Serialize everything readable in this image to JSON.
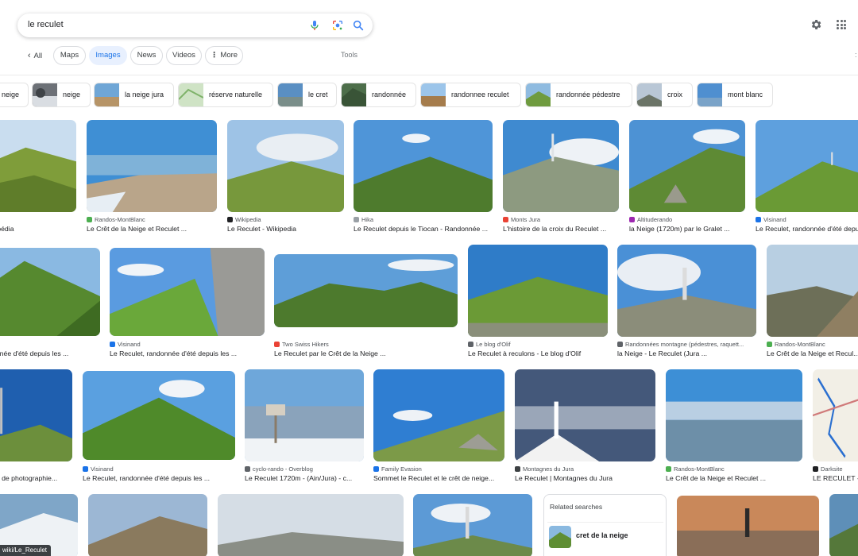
{
  "search": {
    "query": "le reculet"
  },
  "tabs": [
    {
      "key": "all",
      "label": "All"
    },
    {
      "key": "maps",
      "label": "Maps"
    },
    {
      "key": "images",
      "label": "Images"
    },
    {
      "key": "news",
      "label": "News"
    },
    {
      "key": "videos",
      "label": "Videos"
    },
    {
      "key": "more",
      "label": "More"
    }
  ],
  "tools_label": "Tools",
  "chips": [
    "neige",
    "neige",
    "la neige jura",
    "réserve naturelle",
    "le cret",
    "randonnée",
    "randonnee reculet",
    "randonnée pédestre",
    "croix",
    "mont blanc"
  ],
  "results": [
    {
      "source": "",
      "title": "kipédia"
    },
    {
      "source": "Randos-MontBlanc",
      "title": "Le Crêt de la Neige et Reculet ..."
    },
    {
      "source": "Wikipedia",
      "title": "Le Reculet - Wikipedia"
    },
    {
      "source": "Hika",
      "title": "Le Reculet depuis le Tiocan - Randonnée ..."
    },
    {
      "source": "Monts Jura",
      "title": "L'histoire de la croix du Reculet ..."
    },
    {
      "source": "Altituderando",
      "title": "la Neige (1720m) par le Gralet ..."
    },
    {
      "source": "Visinand",
      "title": "Le Reculet, randonnée d'été depuis ..."
    },
    {
      "source": "",
      "title": "onnée d'été depuis les ..."
    },
    {
      "source": "Visinand",
      "title": "Le Reculet, randonnée d'été depuis les ..."
    },
    {
      "source": "Two Swiss Hikers",
      "title": "Le Reculet par le Crêt de la Neige ..."
    },
    {
      "source": "Le blog d'Olif",
      "title": "Le Reculet à reculons - Le blog d'Olif"
    },
    {
      "source": "Randonnées montagne (pédestres, raquett...",
      "title": "la Neige - Le Reculet (Jura ..."
    },
    {
      "source": "Randos-MontBlanc",
      "title": "Le Crêt de la Neige et Recul..."
    },
    {
      "source": "",
      "title": "ue de photographie..."
    },
    {
      "source": "Visinand",
      "title": "Le Reculet, randonnée d'été depuis les ..."
    },
    {
      "source": "cyclo-rando - Overblog",
      "title": "Le Reculet 1720m - (Ain/Jura) - c..."
    },
    {
      "source": "Family Evasion",
      "title": "Sommet le Reculet et le crêt de neige..."
    },
    {
      "source": "Montagnes du Jura",
      "title": "Le Reculet | Montagnes du Jura"
    },
    {
      "source": "Randos-MontBlanc",
      "title": "Le Crêt de la Neige et Reculet ..."
    },
    {
      "source": "Darksite",
      "title": "LE RECULET - ..."
    }
  ],
  "related": {
    "title": "Related searches",
    "item": "cret de la neige"
  },
  "url_tip": "wiki/Le_Reculet",
  "colors": {
    "accent": "#1a73e8",
    "active_tab_bg": "#e8f0fe",
    "text": "#202124",
    "muted": "#4d5156"
  },
  "icons": [
    "back-chevron-icon",
    "mic-icon",
    "lens-icon",
    "search-icon",
    "gear-icon",
    "apps-grid-icon",
    "more-dots-icon"
  ]
}
